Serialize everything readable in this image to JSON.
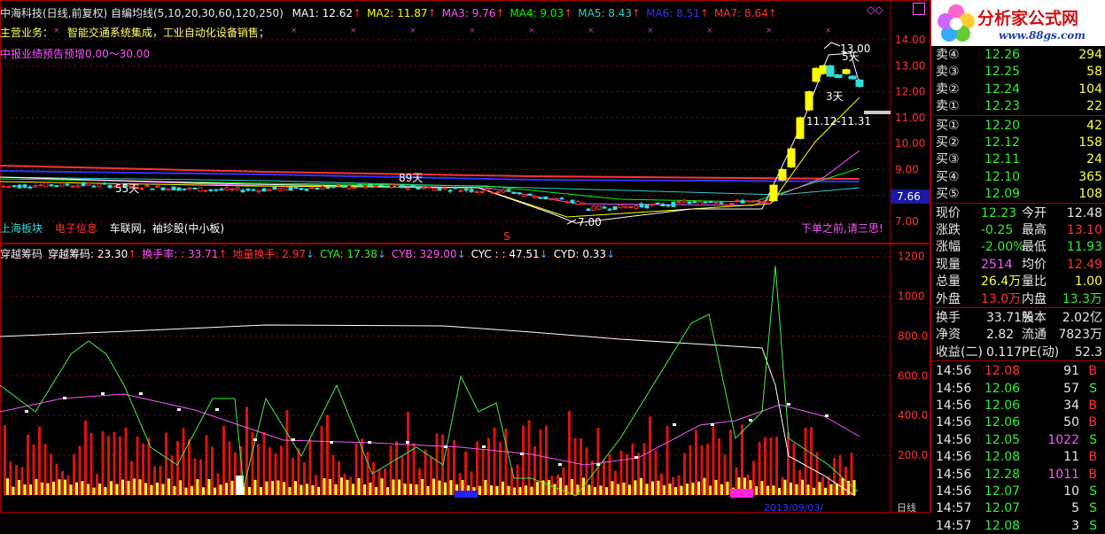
{
  "main": {
    "title": "中海科技(日线,前复权) 自编均线(5,10,20,30,60,120,250)",
    "ma": [
      {
        "label": "MA1: 12.62",
        "arrow": "↑",
        "color": "#ffffff"
      },
      {
        "label": "MA2: 11.87",
        "arrow": "↑",
        "color": "#ffff00"
      },
      {
        "label": "MA3: 9.76",
        "arrow": "↑",
        "color": "#ff55ff"
      },
      {
        "label": "MA4: 9.03",
        "arrow": "↑",
        "color": "#00ff00"
      },
      {
        "label": "MA5: 8.43",
        "arrow": "↑",
        "color": "#33cccc"
      },
      {
        "label": "MA6: 8.51",
        "arrow": "↑",
        "color": "#3333ff"
      },
      {
        "label": "MA7: 8.64",
        "arrow": "↑",
        "color": "#ff3333"
      }
    ],
    "business_label": "主营业务：",
    "business_text": "智能交通系统集成，工业自动化设备销售；",
    "forecast": "中报业绩预告预增0.00～30.00",
    "sector": "上海板块",
    "industry": "电子信息",
    "concepts": "车联网，袖珍股(中小板)",
    "warning": "下单之前,请三思!",
    "annotations": {
      "day55": "55天",
      "day89": "89天",
      "day5": "5天",
      "day3": "3天",
      "high": "13.00",
      "low": "7.00",
      "range": "11.12-11.31",
      "s_marker": "S"
    },
    "y_ticks": [
      "14.00",
      "13.00",
      "12.00",
      "11.00",
      "10.00",
      "9.00",
      "8.00",
      "7.00"
    ],
    "current_price_tag": "7.66"
  },
  "indicator": {
    "title": "穿越筹码",
    "items": [
      {
        "label": "穿越筹码: 23.30",
        "arrow": "↑",
        "color": "#ffffff"
      },
      {
        "label": "换手率: : 33.71",
        "arrow": "↑",
        "color": "#ff55ff"
      },
      {
        "label": "地量换手: 2.97",
        "arrow": "↓",
        "color": "#ff3333"
      },
      {
        "label": "CYA: 17.38",
        "arrow": "↓",
        "color": "#33ee33"
      },
      {
        "label": "CYB: 329.00",
        "arrow": "↓",
        "color": "#ff55ff"
      },
      {
        "label": "CYC : : 47.51",
        "arrow": "↓",
        "color": "#ffffff"
      },
      {
        "label": "CYD: 0.33",
        "arrow": "↓",
        "color": "#ffffff"
      }
    ],
    "y_ticks": [
      "1200",
      "1000",
      "800.0",
      "600.0",
      "400.0",
      "200.0"
    ],
    "bottom_labels": [
      "2013/09/03/",
      "日线"
    ]
  },
  "logo": {
    "title": "分析家公式网",
    "url": "www.88gs.com"
  },
  "quote": {
    "sell": [
      {
        "label": "卖④",
        "price": "12.26",
        "vol": "294"
      },
      {
        "label": "卖③",
        "price": "12.25",
        "vol": "58"
      },
      {
        "label": "卖②",
        "price": "12.24",
        "vol": "104"
      },
      {
        "label": "卖①",
        "price": "12.23",
        "vol": "22"
      }
    ],
    "buy": [
      {
        "label": "买①",
        "price": "12.20",
        "vol": "42"
      },
      {
        "label": "买②",
        "price": "12.12",
        "vol": "158"
      },
      {
        "label": "买③",
        "price": "12.11",
        "vol": "24"
      },
      {
        "label": "买④",
        "price": "12.10",
        "vol": "365"
      },
      {
        "label": "买⑤",
        "price": "12.09",
        "vol": "108"
      }
    ],
    "stats": [
      {
        "l1": "现价",
        "v1": "12.23",
        "c1": "green",
        "l2": "今开",
        "v2": "12.48",
        "c2": "white"
      },
      {
        "l1": "涨跌",
        "v1": "-0.25",
        "c1": "green",
        "l2": "最高",
        "v2": "13.10",
        "c2": "red"
      },
      {
        "l1": "涨幅",
        "v1": "-2.00%",
        "c1": "green",
        "l2": "最低",
        "v2": "11.93",
        "c2": "green"
      },
      {
        "l1": "现量",
        "v1": "2514",
        "c1": "magenta",
        "l2": "均价",
        "v2": "12.49",
        "c2": "red"
      },
      {
        "l1": "总量",
        "v1": "26.4万",
        "c1": "yellow",
        "l2": "量比",
        "v2": "1.00",
        "c2": "yellow"
      },
      {
        "l1": "外盘",
        "v1": "13.0万",
        "c1": "red",
        "l2": "内盘",
        "v2": "13.3万",
        "c2": "green"
      }
    ],
    "fund": [
      {
        "l1": "换手",
        "v1": "33.71%",
        "l2": "股本",
        "v2": "2.02亿"
      },
      {
        "l1": "净资",
        "v1": "2.82",
        "l2": "流通",
        "v2": "7823万"
      },
      {
        "l1": "收益(二)",
        "v1": "0.117",
        "l2": "PE(动)",
        "v2": "52.3"
      }
    ],
    "ticks": [
      {
        "time": "14:56",
        "price": "12.08",
        "pc": "red",
        "vol": "91",
        "vc": "white",
        "bs": "B"
      },
      {
        "time": "14:56",
        "price": "12.06",
        "pc": "green",
        "vol": "57",
        "vc": "white",
        "bs": "S"
      },
      {
        "time": "14:56",
        "price": "12.06",
        "pc": "green",
        "vol": "34",
        "vc": "white",
        "bs": "B"
      },
      {
        "time": "14:56",
        "price": "12.06",
        "pc": "green",
        "vol": "50",
        "vc": "white",
        "bs": "B"
      },
      {
        "time": "14:56",
        "price": "12.05",
        "pc": "green",
        "vol": "1022",
        "vc": "magenta",
        "bs": "S"
      },
      {
        "time": "14:56",
        "price": "12.08",
        "pc": "green",
        "vol": "11",
        "vc": "white",
        "bs": "B"
      },
      {
        "time": "14:56",
        "price": "12.28",
        "pc": "green",
        "vol": "1011",
        "vc": "magenta",
        "bs": "B"
      },
      {
        "time": "14:56",
        "price": "12.07",
        "pc": "green",
        "vol": "10",
        "vc": "white",
        "bs": "S"
      },
      {
        "time": "14:57",
        "price": "12.07",
        "pc": "green",
        "vol": "5",
        "vc": "white",
        "bs": "S"
      },
      {
        "time": "14:57",
        "price": "12.08",
        "pc": "green",
        "vol": "3",
        "vc": "white",
        "bs": "S"
      }
    ]
  },
  "colors": {
    "bg": "#000000",
    "grid": "#a00000",
    "up": "#ff3333",
    "down": "#33dddd",
    "ma5": "#ffffff",
    "ma10": "#ffff00",
    "ma20": "#ff55ff",
    "ma30": "#00ff00",
    "ma60": "#33cccc",
    "ma120": "#3333ff",
    "ma250": "#ff3333"
  }
}
